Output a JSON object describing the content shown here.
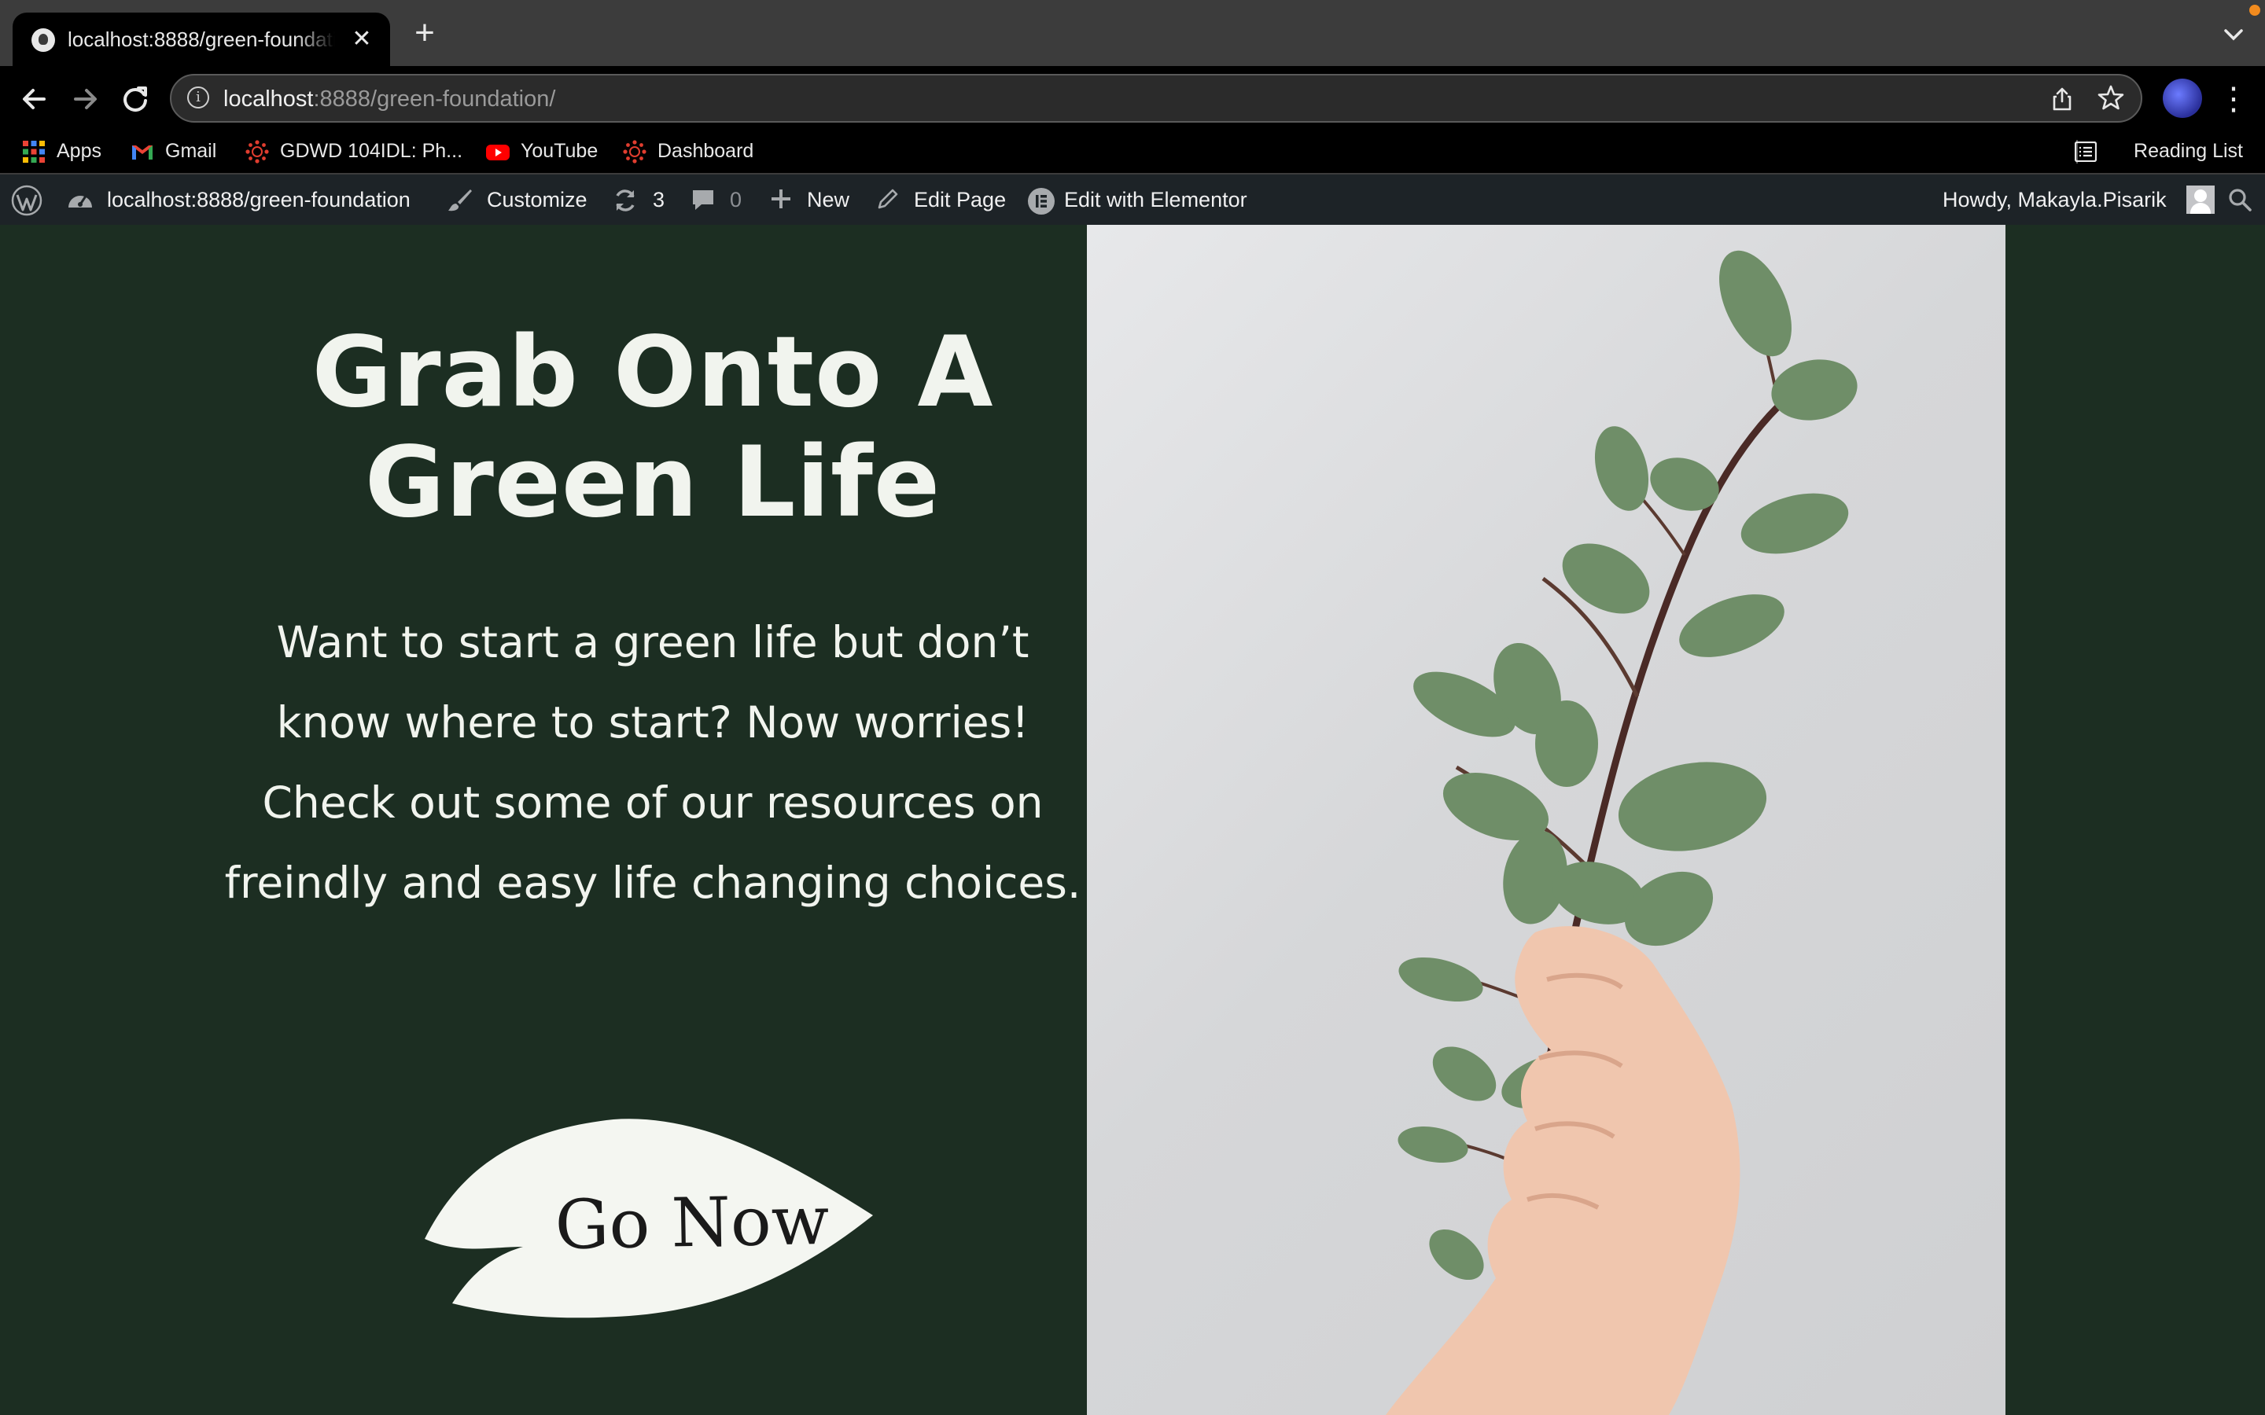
{
  "browser": {
    "tab_title": "localhost:8888/green-foundation/",
    "tab_close": "✕",
    "new_tab": "+",
    "url_host": "localhost",
    "url_rest": ":8888/green-foundation/",
    "menu_icon": "⋮"
  },
  "bookmarks": [
    {
      "label": "Apps",
      "icon": "apps-grid-icon"
    },
    {
      "label": "Gmail",
      "icon": "gmail-icon"
    },
    {
      "label": "GDWD 104IDL: Ph...",
      "icon": "canvas-icon"
    },
    {
      "label": "YouTube",
      "icon": "youtube-icon"
    },
    {
      "label": "Dashboard",
      "icon": "canvas-icon"
    }
  ],
  "reading_list": "Reading List",
  "adminbar": {
    "site": "localhost:8888/green-foundation",
    "customize": "Customize",
    "updates": "3",
    "comments": "0",
    "new": "New",
    "edit_page": "Edit Page",
    "elementor": "Edit with Elementor",
    "howdy": "Howdy, Makayla.Pisarik"
  },
  "hero": {
    "title_line1": "Grab Onto A",
    "title_line2": "Green Life",
    "text_line1": "Want to start a green life but don’t",
    "text_line2": "know where to start? Now worries!",
    "text_line3": "Check out some of our resources on",
    "text_line4": "freindly and easy life changing choices.",
    "button_label": "Go Now"
  },
  "colors": {
    "page_bg": "#1c2e22",
    "text_light": "#f1f4ee",
    "adminbar_bg": "#1d2327",
    "leaf_green": "#6f8e68"
  }
}
